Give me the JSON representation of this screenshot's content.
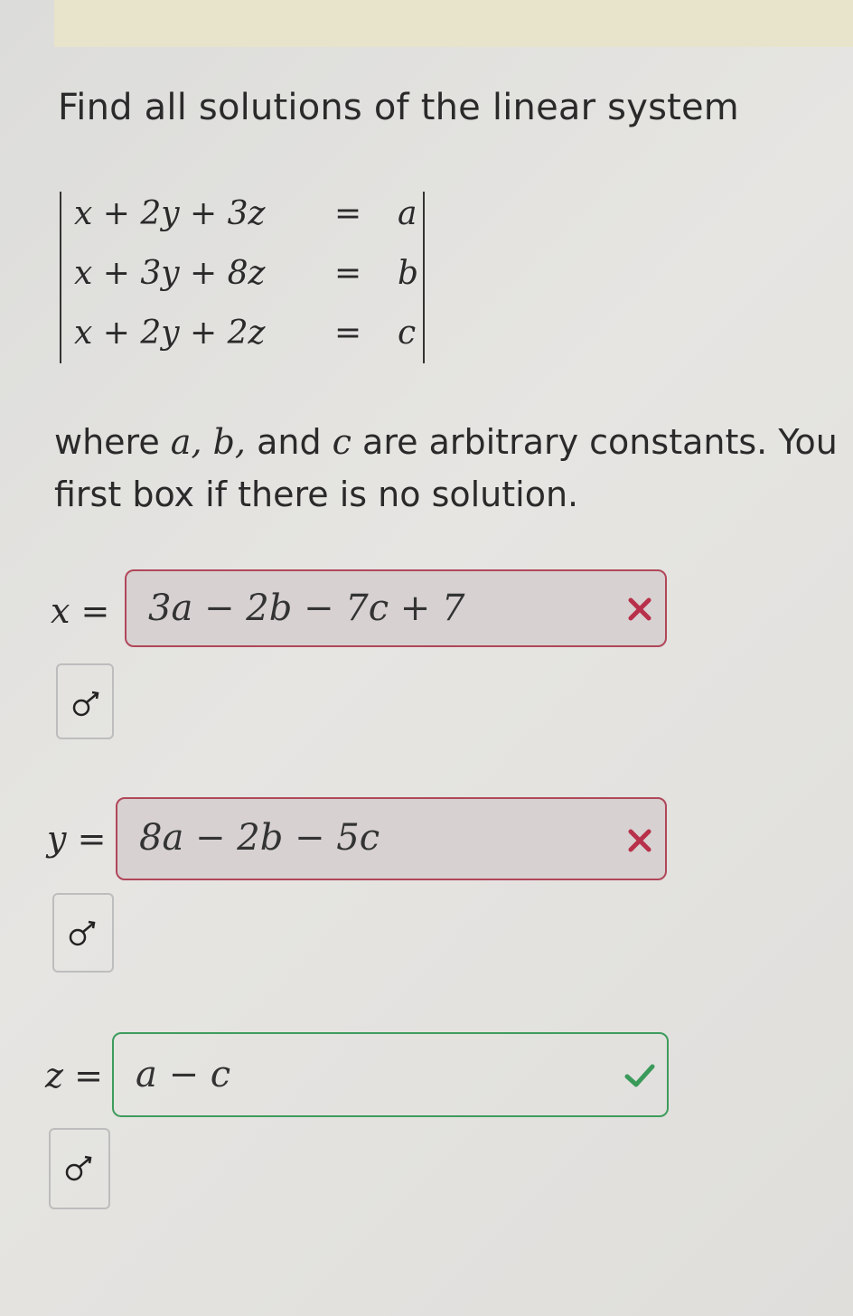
{
  "question": {
    "prompt": "Find all solutions of the linear system",
    "equations": [
      {
        "lhs": "x + 2y + 3z",
        "eq": "=",
        "rhs": "a"
      },
      {
        "lhs": "x + 3y + 8z",
        "eq": "=",
        "rhs": "b"
      },
      {
        "lhs": "x + 2y + 2z",
        "eq": "=",
        "rhs": "c"
      }
    ],
    "description_parts": {
      "p1": "where ",
      "vars": "a, b,",
      "p2": " and ",
      "var_c": "c",
      "p3": " are arbitrary constants. You",
      "line2": "first box if there is no solution."
    }
  },
  "answers": [
    {
      "var": "x",
      "eq": "=",
      "value": "3a − 2b − 7c + 7",
      "status": "incorrect",
      "status_icon": "x-mark-icon"
    },
    {
      "var": "y",
      "eq": "=",
      "value": "8a − 2b − 5c",
      "status": "incorrect",
      "status_icon": "x-mark-icon"
    },
    {
      "var": "z",
      "eq": "=",
      "value": "a − c",
      "status": "correct",
      "status_icon": "check-mark-icon"
    }
  ],
  "tool_icon": "math-input-tool-icon",
  "colors": {
    "incorrect_border": "#b0475a",
    "incorrect_icon": "#b8304a",
    "correct_border": "#3e9c5c",
    "correct_icon": "#3a9a5a",
    "banner": "#e7e4cb"
  }
}
